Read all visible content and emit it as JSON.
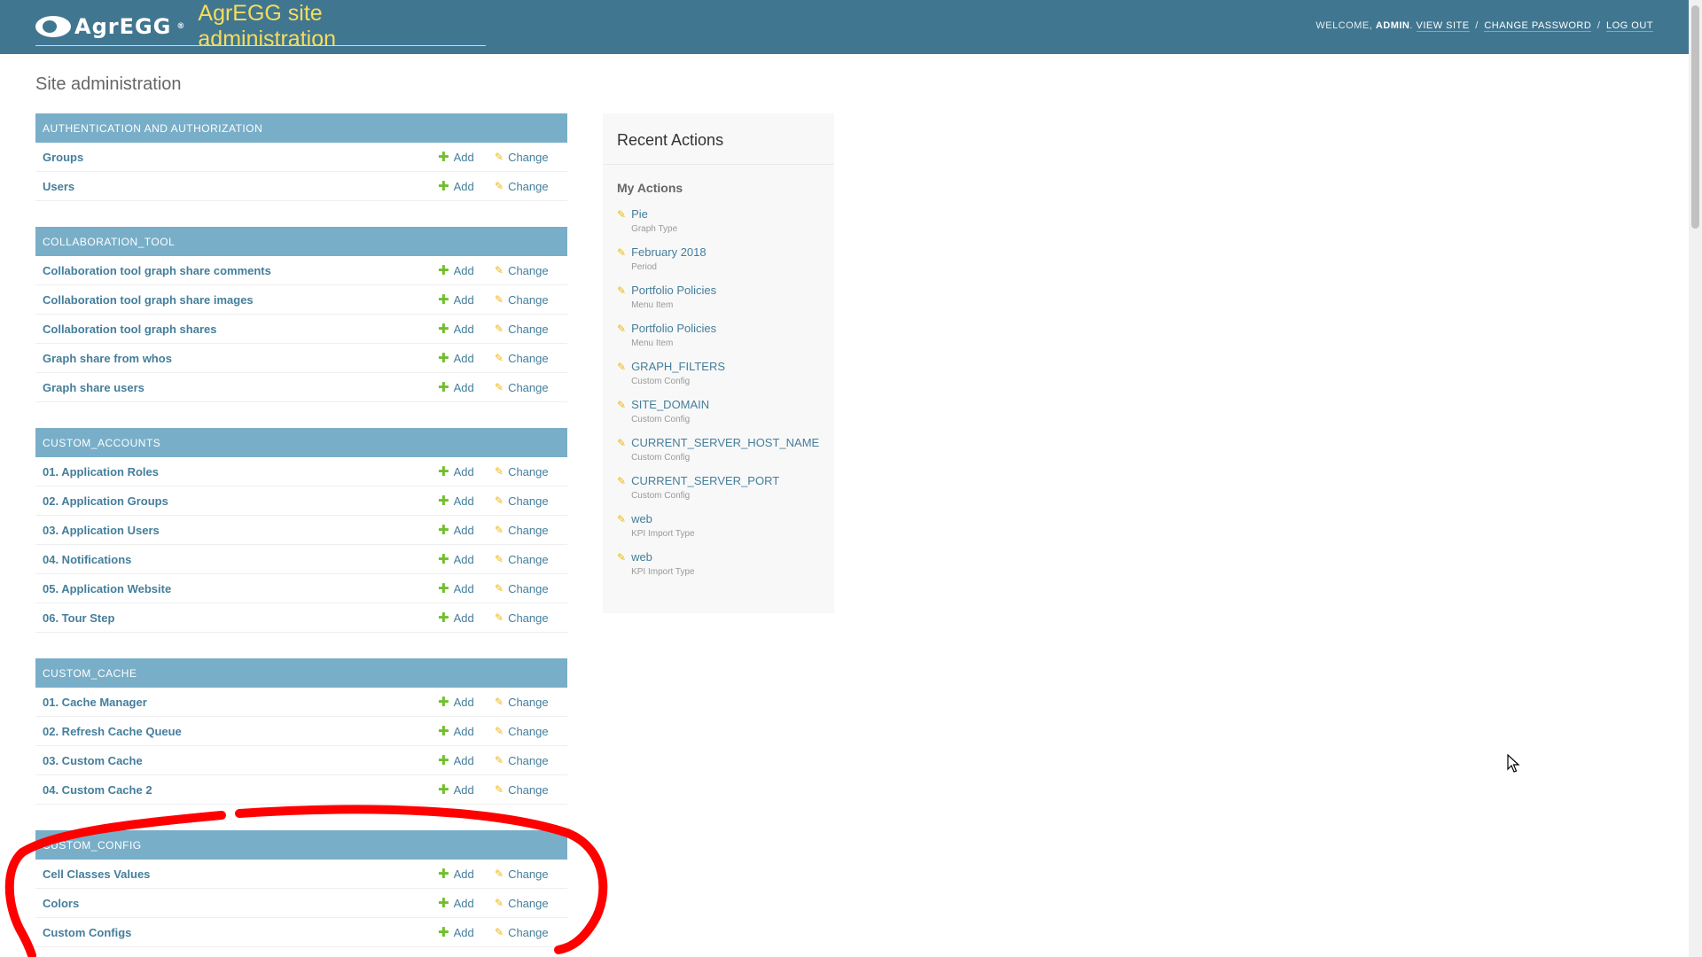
{
  "header": {
    "logo_text": "AgrEGG",
    "logo_mark": "®",
    "site_name": "AgrEGG site administration",
    "welcome": "Welcome,",
    "username": "admin",
    "view_site": "View site",
    "change_password": "Change password",
    "log_out": "Log out",
    "separator": "/"
  },
  "page_title": "Site administration",
  "labels": {
    "add": "Add",
    "change": "Change"
  },
  "modules": [
    {
      "caption": "Authentication and Authorization",
      "models": [
        "Groups",
        "Users"
      ]
    },
    {
      "caption": "COLLABORATION_TOOL",
      "models": [
        "Collaboration tool graph share comments",
        "Collaboration tool graph share images",
        "Collaboration tool graph shares",
        "Graph share from whos",
        "Graph share users"
      ]
    },
    {
      "caption": "CUSTOM_ACCOUNTS",
      "models": [
        "01. Application Roles",
        "02. Application Groups",
        "03. Application Users",
        "04. Notifications",
        "05. Application Website",
        "06. Tour Step"
      ]
    },
    {
      "caption": "CUSTOM_CACHE",
      "models": [
        "01. Cache Manager",
        "02. Refresh Cache Queue",
        "03. Custom Cache",
        "04. Custom Cache 2"
      ]
    },
    {
      "caption": "CUSTOM_CONFIG",
      "models": [
        "Cell Classes Values",
        "Colors",
        "Custom Configs"
      ]
    }
  ],
  "recent_actions": {
    "title": "Recent Actions",
    "subtitle": "My Actions",
    "items": [
      {
        "name": "Pie",
        "type": "Graph Type"
      },
      {
        "name": "February 2018",
        "type": "Period"
      },
      {
        "name": "Portfolio Policies",
        "type": "Menu Item"
      },
      {
        "name": "Portfolio Policies",
        "type": "Menu Item"
      },
      {
        "name": "GRAPH_FILTERS",
        "type": "Custom Config"
      },
      {
        "name": "SITE_DOMAIN",
        "type": "Custom Config"
      },
      {
        "name": "CURRENT_SERVER_HOST_NAME",
        "type": "Custom Config"
      },
      {
        "name": "CURRENT_SERVER_PORT",
        "type": "Custom Config"
      },
      {
        "name": "web",
        "type": "KPI Import Type"
      },
      {
        "name": "web",
        "type": "KPI Import Type"
      }
    ]
  },
  "icons": {
    "add": "plus-icon",
    "change": "pencil-icon"
  },
  "colors": {
    "header_bg": "#417690",
    "site_name": "#f5dd5d",
    "module_caption_bg": "#79aec8",
    "link": "#447e9b",
    "add_icon": "#70bf2b",
    "change_icon": "#efb80b",
    "annotation": "#ff0000"
  }
}
